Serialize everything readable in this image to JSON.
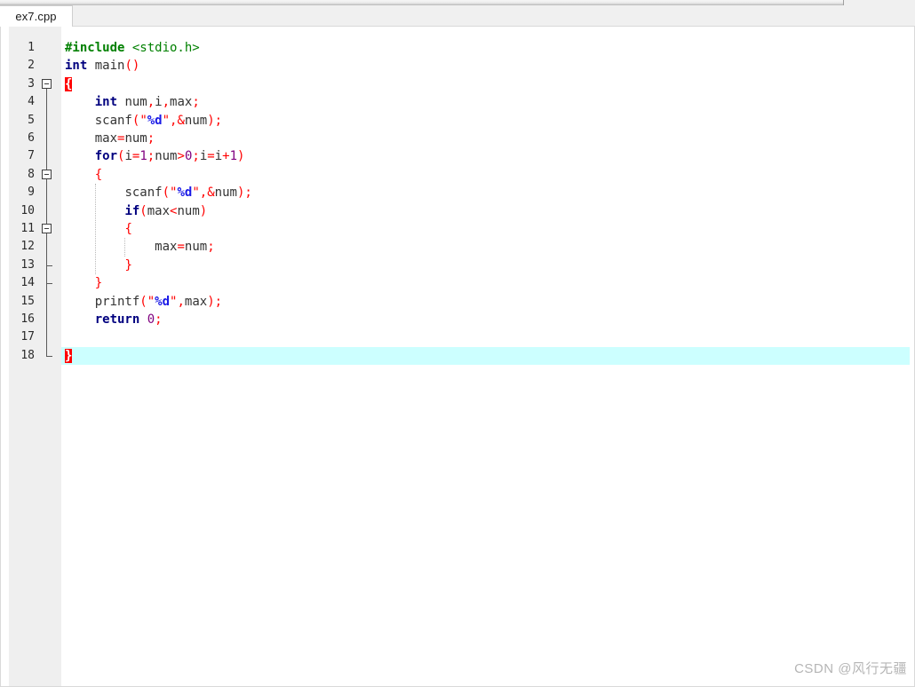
{
  "window": {
    "tab": {
      "label": "ex7.cpp"
    }
  },
  "editor": {
    "language": "C++",
    "current_line": 18,
    "colors": {
      "preprocessor": "#008000",
      "keyword": "#00007f",
      "identifier": "#333333",
      "operator": "#ff0000",
      "string": "#ff0000",
      "format_specifier": "#1a1ae6",
      "number": "#7f007f",
      "matching_brace_bg": "#ff0000",
      "current_line_bg": "#ccffff",
      "gutter_bg": "#efefef",
      "editor_bg": "#ffffff"
    },
    "line_numbers": [
      "1",
      "2",
      "3",
      "4",
      "5",
      "6",
      "7",
      "8",
      "9",
      "10",
      "11",
      "12",
      "13",
      "14",
      "15",
      "16",
      "17",
      "18"
    ],
    "lines": [
      {
        "n": "1",
        "indent": 0,
        "tokens": [
          {
            "t": "#include ",
            "c": "t-pre"
          },
          {
            "t": "<stdio.h>",
            "c": "t-inc"
          }
        ]
      },
      {
        "n": "2",
        "indent": 0,
        "tokens": [
          {
            "t": "int",
            "c": "t-kw"
          },
          {
            "t": " ",
            "c": "t-id"
          },
          {
            "t": "main",
            "c": "t-fn"
          },
          {
            "t": "()",
            "c": "t-punc"
          }
        ]
      },
      {
        "n": "3",
        "indent": 0,
        "tokens": [
          {
            "t": "{",
            "c": "t-brace-hl"
          }
        ]
      },
      {
        "n": "4",
        "indent": 1,
        "tokens": [
          {
            "t": "int",
            "c": "t-kw"
          },
          {
            "t": " num",
            "c": "t-id"
          },
          {
            "t": ",",
            "c": "t-punc"
          },
          {
            "t": "i",
            "c": "t-id"
          },
          {
            "t": ",",
            "c": "t-punc"
          },
          {
            "t": "max",
            "c": "t-id"
          },
          {
            "t": ";",
            "c": "t-punc"
          }
        ]
      },
      {
        "n": "5",
        "indent": 1,
        "tokens": [
          {
            "t": "scanf",
            "c": "t-fn"
          },
          {
            "t": "(",
            "c": "t-punc"
          },
          {
            "t": "\"",
            "c": "t-str"
          },
          {
            "t": "%d",
            "c": "t-fmt"
          },
          {
            "t": "\"",
            "c": "t-str"
          },
          {
            "t": ",",
            "c": "t-punc"
          },
          {
            "t": "&",
            "c": "t-op"
          },
          {
            "t": "num",
            "c": "t-id"
          },
          {
            "t": ")",
            "c": "t-punc"
          },
          {
            "t": ";",
            "c": "t-punc"
          }
        ]
      },
      {
        "n": "6",
        "indent": 1,
        "tokens": [
          {
            "t": "max",
            "c": "t-id"
          },
          {
            "t": "=",
            "c": "t-op"
          },
          {
            "t": "num",
            "c": "t-id"
          },
          {
            "t": ";",
            "c": "t-punc"
          }
        ]
      },
      {
        "n": "7",
        "indent": 1,
        "tokens": [
          {
            "t": "for",
            "c": "t-kw"
          },
          {
            "t": "(",
            "c": "t-punc"
          },
          {
            "t": "i",
            "c": "t-id"
          },
          {
            "t": "=",
            "c": "t-op"
          },
          {
            "t": "1",
            "c": "t-num"
          },
          {
            "t": ";",
            "c": "t-punc"
          },
          {
            "t": "num",
            "c": "t-id"
          },
          {
            "t": ">",
            "c": "t-op"
          },
          {
            "t": "0",
            "c": "t-num"
          },
          {
            "t": ";",
            "c": "t-punc"
          },
          {
            "t": "i",
            "c": "t-id"
          },
          {
            "t": "=",
            "c": "t-op"
          },
          {
            "t": "i",
            "c": "t-id"
          },
          {
            "t": "+",
            "c": "t-op"
          },
          {
            "t": "1",
            "c": "t-num"
          },
          {
            "t": ")",
            "c": "t-punc"
          }
        ]
      },
      {
        "n": "8",
        "indent": 1,
        "tokens": [
          {
            "t": "{",
            "c": "t-punc"
          }
        ]
      },
      {
        "n": "9",
        "indent": 2,
        "tokens": [
          {
            "t": "scanf",
            "c": "t-fn"
          },
          {
            "t": "(",
            "c": "t-punc"
          },
          {
            "t": "\"",
            "c": "t-str"
          },
          {
            "t": "%d",
            "c": "t-fmt"
          },
          {
            "t": "\"",
            "c": "t-str"
          },
          {
            "t": ",",
            "c": "t-punc"
          },
          {
            "t": "&",
            "c": "t-op"
          },
          {
            "t": "num",
            "c": "t-id"
          },
          {
            "t": ")",
            "c": "t-punc"
          },
          {
            "t": ";",
            "c": "t-punc"
          }
        ]
      },
      {
        "n": "10",
        "indent": 2,
        "tokens": [
          {
            "t": "if",
            "c": "t-kw"
          },
          {
            "t": "(",
            "c": "t-punc"
          },
          {
            "t": "max",
            "c": "t-id"
          },
          {
            "t": "<",
            "c": "t-op"
          },
          {
            "t": "num",
            "c": "t-id"
          },
          {
            "t": ")",
            "c": "t-punc"
          }
        ]
      },
      {
        "n": "11",
        "indent": 2,
        "tokens": [
          {
            "t": "{",
            "c": "t-punc"
          }
        ]
      },
      {
        "n": "12",
        "indent": 3,
        "tokens": [
          {
            "t": "max",
            "c": "t-id"
          },
          {
            "t": "=",
            "c": "t-op"
          },
          {
            "t": "num",
            "c": "t-id"
          },
          {
            "t": ";",
            "c": "t-punc"
          }
        ]
      },
      {
        "n": "13",
        "indent": 2,
        "tokens": [
          {
            "t": "}",
            "c": "t-punc"
          }
        ]
      },
      {
        "n": "14",
        "indent": 1,
        "tokens": [
          {
            "t": "}",
            "c": "t-punc"
          }
        ]
      },
      {
        "n": "15",
        "indent": 1,
        "tokens": [
          {
            "t": "printf",
            "c": "t-fn"
          },
          {
            "t": "(",
            "c": "t-punc"
          },
          {
            "t": "\"",
            "c": "t-str"
          },
          {
            "t": "%d",
            "c": "t-fmt"
          },
          {
            "t": "\"",
            "c": "t-str"
          },
          {
            "t": ",",
            "c": "t-punc"
          },
          {
            "t": "max",
            "c": "t-id"
          },
          {
            "t": ")",
            "c": "t-punc"
          },
          {
            "t": ";",
            "c": "t-punc"
          }
        ]
      },
      {
        "n": "16",
        "indent": 1,
        "tokens": [
          {
            "t": "return",
            "c": "t-kw"
          },
          {
            "t": " ",
            "c": "t-id"
          },
          {
            "t": "0",
            "c": "t-num"
          },
          {
            "t": ";",
            "c": "t-punc"
          }
        ]
      },
      {
        "n": "17",
        "indent": 0,
        "tokens": []
      },
      {
        "n": "18",
        "indent": 0,
        "tokens": [
          {
            "t": "}",
            "c": "t-brace-hl"
          }
        ]
      }
    ],
    "fold_markers": [
      {
        "line": 3,
        "type": "box"
      },
      {
        "line": 8,
        "type": "box"
      },
      {
        "line": 11,
        "type": "box"
      },
      {
        "line": 13,
        "type": "tick"
      },
      {
        "line": 14,
        "type": "tick"
      },
      {
        "line": 18,
        "type": "end"
      }
    ],
    "source_text": "#include <stdio.h>\nint main()\n{\n    int num,i,max;\n    scanf(\"%d\",&num);\n    max=num;\n    for(i=1;num>0;i=i+1)\n    {\n        scanf(\"%d\",&num);\n        if(max<num)\n        {\n            max=num;\n        }\n    }\n    printf(\"%d\",max);\n    return 0;\n\n}"
  },
  "watermark": {
    "text": "CSDN @风行无疆"
  }
}
